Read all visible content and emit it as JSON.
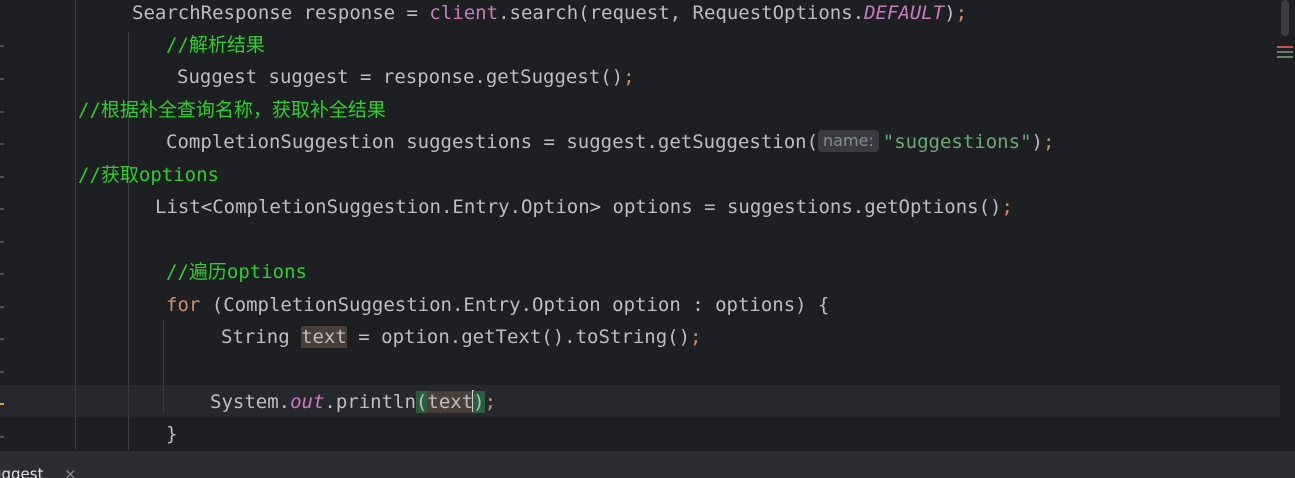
{
  "editor": {
    "lines": [
      {
        "a": "SearchResponse response = ",
        "b": "client",
        "c": ".search(request, RequestOptions.",
        "d": "DEFAULT",
        "e": ")",
        "f": ";"
      },
      {
        "comment": "//解析结果"
      },
      {
        "a": "Suggest suggest = response.getSuggest()",
        "f": ";"
      },
      {
        "comment": "//根据补全查询名称，获取补全结果"
      },
      {
        "a": "CompletionSuggestion suggestions = suggest.getSuggestion(",
        "hint": "name:",
        "str": "\"suggestions\"",
        "e": ")",
        "f": ";"
      },
      {
        "comment": "//获取options"
      },
      {
        "a": "List<CompletionSuggestion.Entry.Option> options = suggestions.getOptions()",
        "f": ";"
      },
      {
        "comment": "//遍历options"
      },
      {
        "kw": "for",
        "a": " (CompletionSuggestion.Entry.Option option : options) {"
      },
      {
        "a": "String ",
        "var": "text",
        "b": " = option.getText().toString()",
        "f": ";"
      },
      {
        "a": "System.",
        "field": "out",
        "b": ".println",
        "open": "(",
        "var": "text",
        "close": ")",
        "f": ";"
      },
      {
        "a": "}"
      }
    ]
  },
  "bottom_tab": {
    "label": "uggest",
    "close": "×"
  },
  "colors": {
    "background": "#1e1f22",
    "keyword": "#cf8e6d",
    "comment": "#2bd02b",
    "string": "#6aab73",
    "field": "#c77dbb"
  }
}
